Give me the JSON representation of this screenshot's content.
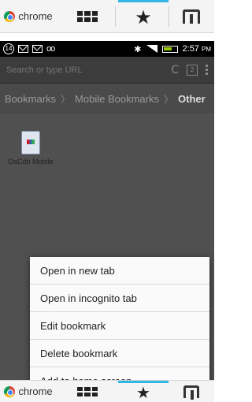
{
  "desktop_toolbar": {
    "chrome_label": "chrome",
    "icons": [
      "chrome-icon",
      "grid-icon",
      "star-icon",
      "app-icon"
    ]
  },
  "status_bar": {
    "notification_count": "14",
    "voicemail": "oo",
    "time": "2:57",
    "ampm": "PM"
  },
  "url_bar": {
    "placeholder": "Search or type URL",
    "tab_count": "2"
  },
  "breadcrumb": {
    "items": [
      "Bookmarks",
      "Mobile Bookmarks",
      "Other"
    ]
  },
  "bookmark": {
    "label": "DaCdb Mobile"
  },
  "context_menu": {
    "items": [
      "Open in new tab",
      "Open in incognito tab",
      "Edit bookmark",
      "Delete bookmark",
      "Add to home screen"
    ]
  },
  "colors": {
    "accent_blue": "#33b5e5",
    "screen_background": "#505050",
    "menu_background": "#fafafa"
  }
}
